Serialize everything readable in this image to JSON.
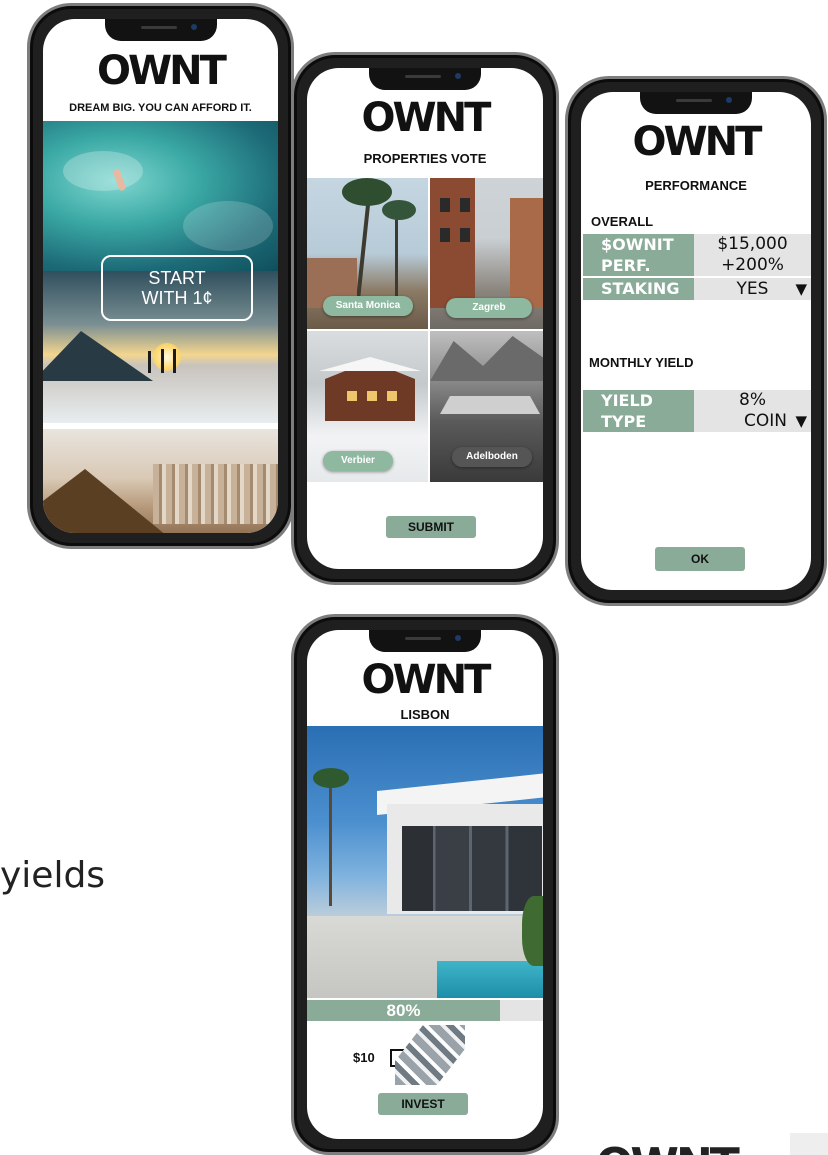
{
  "brand": {
    "logo": "OWNT"
  },
  "phone1": {
    "tagline": "DREAM BIG. YOU CAN AFFORD IT.",
    "cta_line1": "START",
    "cta_line2": "WITH 1¢"
  },
  "phone2": {
    "title": "PROPERTIES VOTE",
    "properties": [
      "Santa Monica",
      "Zagreb",
      "Verbier",
      "Adelboden"
    ],
    "submit_label": "SUBMIT"
  },
  "phone3": {
    "title": "PERFORMANCE",
    "overall_heading": "OVERALL",
    "overall": {
      "ownit_label": "$OWNIT",
      "ownit_value": "$15,000",
      "perf_label": "PERF.",
      "perf_value": "+200%",
      "staking_label": "STAKING",
      "staking_value": "YES"
    },
    "monthly_heading": "MONTHLY YIELD",
    "monthly": {
      "yield_label": "YIELD",
      "yield_value": "8%",
      "type_label": "TYPE",
      "type_value": "COIN"
    },
    "ok_label": "OK"
  },
  "phone4": {
    "city": "LISBON",
    "progress_label": "80%",
    "progress": 0.8,
    "price": "$10",
    "invest_label": "INVEST"
  },
  "side_text": "yields",
  "colors": {
    "accent": "#8aab98",
    "cell_bg": "#e4e4e4",
    "frame": "#1f1f1f"
  }
}
